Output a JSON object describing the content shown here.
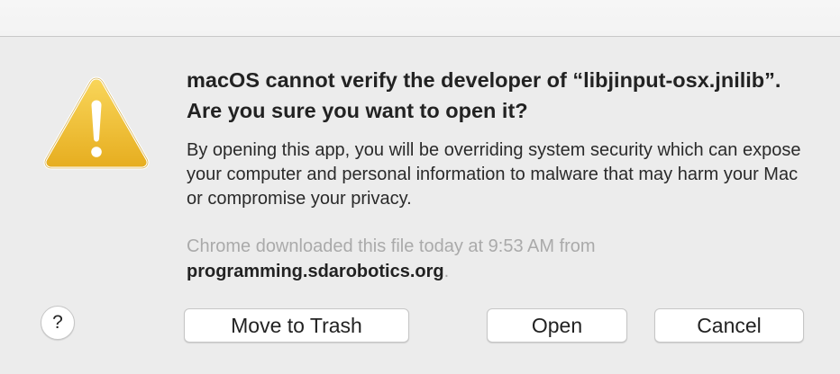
{
  "dialog": {
    "title": "macOS cannot verify the developer of “libjinput-osx.jnilib”. Are you sure you want to open it?",
    "body": "By opening this app, you will be overriding system security which can expose your computer and personal information to malware that may harm your Mac or compromise your privacy.",
    "source_line": "Chrome downloaded this file today at 9:53 AM from",
    "source_domain": "programming.sdarobotics.org",
    "source_suffix": ".",
    "icon": "warning-triangle-icon",
    "accent_color": "#f2c33a"
  },
  "buttons": {
    "help_label": "?",
    "move_to_trash_label": "Move to Trash",
    "open_label": "Open",
    "cancel_label": "Cancel"
  }
}
